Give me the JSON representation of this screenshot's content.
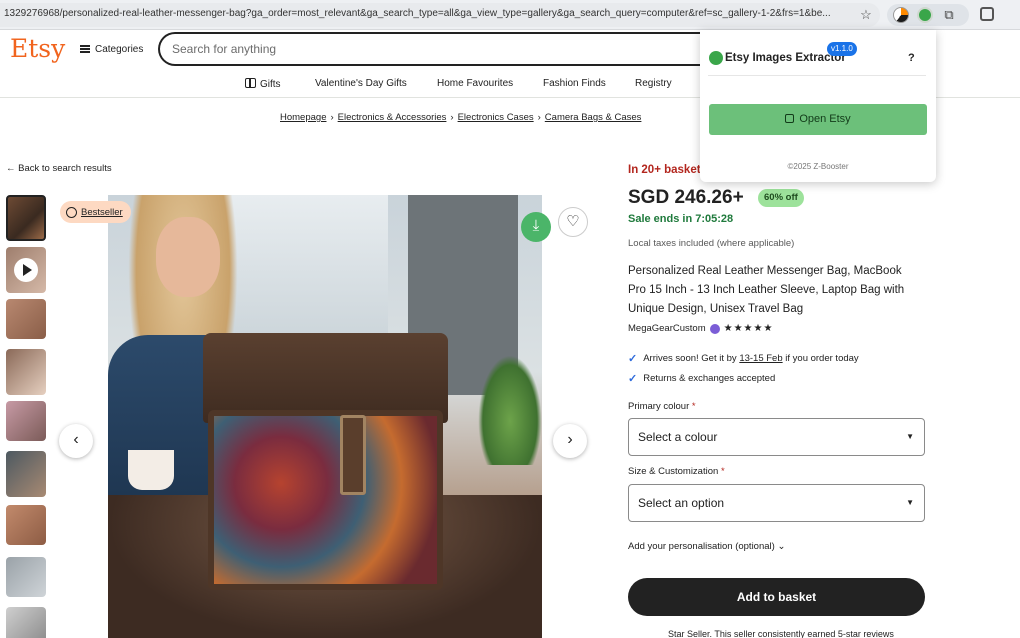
{
  "browser": {
    "url": "1329276968/personalized-real-leather-messenger-bag?ga_order=most_relevant&ga_search_type=all&ga_view_type=gallery&ga_search_query=computer&ref=sc_gallery-1-2&frs=1&be..."
  },
  "header": {
    "logo": "Etsy",
    "categories_label": "Categories",
    "search_placeholder": "Search for anything"
  },
  "nav": {
    "items": [
      "Gifts",
      "Valentine's Day Gifts",
      "Home Favourites",
      "Fashion Finds",
      "Registry"
    ]
  },
  "breadcrumb": [
    "Homepage",
    "Electronics & Accessories",
    "Electronics Cases",
    "Camera Bags & Cases"
  ],
  "back_link": "← Back to search results",
  "gallery": {
    "badge": "Bestseller",
    "prev_icon": "chevron-left-icon",
    "next_icon": "chevron-right-icon"
  },
  "product": {
    "basket_alert": "In 20+ basket",
    "price": "SGD 246.26+",
    "discount": "60% off",
    "sale_ends": "Sale ends in 7:05:28",
    "taxes": "Local taxes included (where applicable)",
    "title": "Personalized Real Leather Messenger Bag, MacBook Pro 15 Inch - 13 Inch Leather Sleeve, Laptop Bag with Unique Design, Unisex Travel Bag",
    "shop_name": "MegaGearCustom",
    "rating_stars": "★★★★★",
    "arrives_prefix": "Arrives soon! Get it by",
    "arrives_date": "13-15 Feb",
    "arrives_suffix": "if you order today",
    "returns": "Returns & exchanges accepted",
    "primary_colour_label": "Primary colour",
    "primary_colour_value": "Select a colour",
    "size_label": "Size & Customization",
    "size_value": "Select an option",
    "personalisation": "Add your personalisation (optional)",
    "add_to_basket": "Add to basket",
    "star_seller_note": "Star Seller. This seller consistently earned 5-star reviews"
  },
  "extension_popup": {
    "title": "Etsy Images Extractor",
    "version": "v1.1.0",
    "help": "?",
    "open_button": "Open Etsy",
    "copyright": "©2025 Z-Booster"
  },
  "colors": {
    "etsy_orange": "#f1641e",
    "sale_green": "#1f7a3c",
    "alert_red": "#b3261e",
    "extension_green": "#6cc07a"
  }
}
